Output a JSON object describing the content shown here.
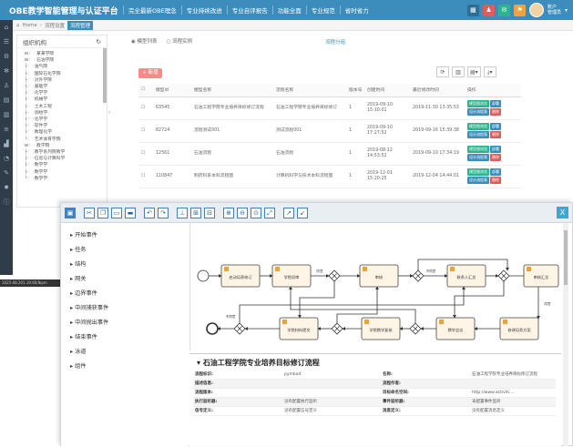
{
  "topbar": {
    "title": "OBE教学智能管理与认证平台",
    "nav": [
      "完全最新OBE理念",
      "专业持续改进",
      "专业自评报告",
      "功能全面",
      "专业规范",
      "省时省力"
    ],
    "user_line1": "账户",
    "user_line2": "管理员"
  },
  "breadcrumb": {
    "home": "Home",
    "sep": "›",
    "item": "流程设置",
    "tab": "流程管理"
  },
  "org": {
    "title": "组织机构",
    "tree": [
      "⊟ 🗁 某某学院",
      "  ⊟ 🗁 石油学院",
      "     ├ 🗀 油气院",
      "     ├ 🗀 国际石化学院",
      "     ├ 🗀 对外学院",
      "     ├ 🗀 基础学",
      "     ├ 🗀 化学学",
      "     ├ 🗀 机械学",
      "     ├ 🗀 土木工程",
      "     ├ 🗀 测绘学",
      "     ├ 🗀 化学学",
      "     ├ 🗀 软件学",
      "     ├ 🗀 数理化学",
      "     └ 🗀 艺术体育学院",
      "  ⊟ 🗁 教学院",
      "     ├ 🗀 教学系列院教学",
      "     ├ 🗀 信息与计算科学",
      "     ├ 🗀 数学学",
      "     ├ 🗀 数学学",
      "     └ 🗀 数学学"
    ]
  },
  "main": {
    "radio1": "◉ 模型列表",
    "radio2": "○ 流程实例",
    "flow_link": "流程分组",
    "add_label": "+ 新增",
    "tools": [
      "⟳",
      "▥",
      "▤▾",
      "⤓▾"
    ],
    "columns": [
      "",
      "模型id",
      "模型名称",
      "流程名称",
      "版本号",
      "创建时间",
      "最近修改时间",
      "操作"
    ],
    "rows": [
      {
        "id": "63545",
        "model": "石油工程学院专业培养目标修订流程",
        "flow": "石油工程学院专业培养目标修订",
        "ver": "1",
        "created": "2019-09-10 15:10:01",
        "modified": "2019-11-30 13:35:53"
      },
      {
        "id": "82724",
        "model": "流程测试001",
        "flow": "测试流程001",
        "ver": "1",
        "created": "2019-09-10 17:27:52",
        "modified": "2019-09-16 15:39:38"
      },
      {
        "id": "12561",
        "model": "石油流程",
        "flow": "石油流程",
        "ver": "1",
        "created": "2019-08-12 14:53:52",
        "modified": "2019-09-10 17:34:19"
      },
      {
        "id": "110847",
        "model": "制药科系本科流程图",
        "flow": "计算机科学与技术本科流程图",
        "ver": "1",
        "created": "2019-12-01 15:20:25",
        "modified": "2019-12-04 14:44:01"
      }
    ],
    "ops": [
      [
        {
          "t": "模型图浏览",
          "c": "g"
        },
        {
          "t": "部署",
          "c": "b"
        },
        {
          "t": "设计流程表",
          "c": "b"
        },
        {
          "t": "删除",
          "c": "r"
        }
      ],
      [
        {
          "t": "模型图浏览",
          "c": "g"
        },
        {
          "t": "部署",
          "c": "b"
        },
        {
          "t": "设计流程表",
          "c": "b"
        },
        {
          "t": "删除",
          "c": "r"
        }
      ],
      [
        {
          "t": "模型图浏览",
          "c": "g"
        },
        {
          "t": "部署",
          "c": "b"
        },
        {
          "t": "设计流程表",
          "c": "b"
        },
        {
          "t": "删除",
          "c": "r"
        }
      ],
      [
        {
          "t": "模型图浏览",
          "c": "g"
        },
        {
          "t": "部署",
          "c": "b"
        },
        {
          "t": "设计流程表",
          "c": "b"
        },
        {
          "t": "删除",
          "c": "r"
        }
      ]
    ]
  },
  "tooltip": "1025-08.201.19.60/lbpm",
  "modal": {
    "close": "X",
    "palette": [
      "开始事件",
      "任务",
      "结构",
      "网关",
      "边界事件",
      "中间捕获事件",
      "中间抛出事件",
      "结束事件",
      "泳道",
      "组件"
    ],
    "nodes": [
      "启动培养修订",
      "学院初审",
      "审核",
      "联系人汇总",
      "审核汇总",
      "学院材料提交",
      "学院教学复核",
      "教学会议",
      "专家审核",
      "修改培养方案"
    ],
    "edge_labels": [
      "同意",
      "不同意",
      "同意",
      "不同意"
    ],
    "props_title": "石油工程学院专业培养目标修订流程",
    "props_left": [
      {
        "k": "流程标识:",
        "v": "pymbxd"
      },
      {
        "k": "描述信息:",
        "v": ""
      },
      {
        "k": "流程版本:",
        "v": ""
      },
      {
        "k": "执行监听器:",
        "v": "没有配置执行监听"
      },
      {
        "k": "信号定义:",
        "v": "没有配置信号定义"
      }
    ],
    "props_right": [
      {
        "k": "名称:",
        "v": "石油工程学院专业培养目标修订流程"
      },
      {
        "k": "流程作者:",
        "v": ""
      },
      {
        "k": "目标命名空间:",
        "v": "http://www.activiti...."
      },
      {
        "k": "事件监听器:",
        "v": "未配置事件监听"
      },
      {
        "k": "消息定义:",
        "v": "没有配置消息定义"
      }
    ]
  }
}
